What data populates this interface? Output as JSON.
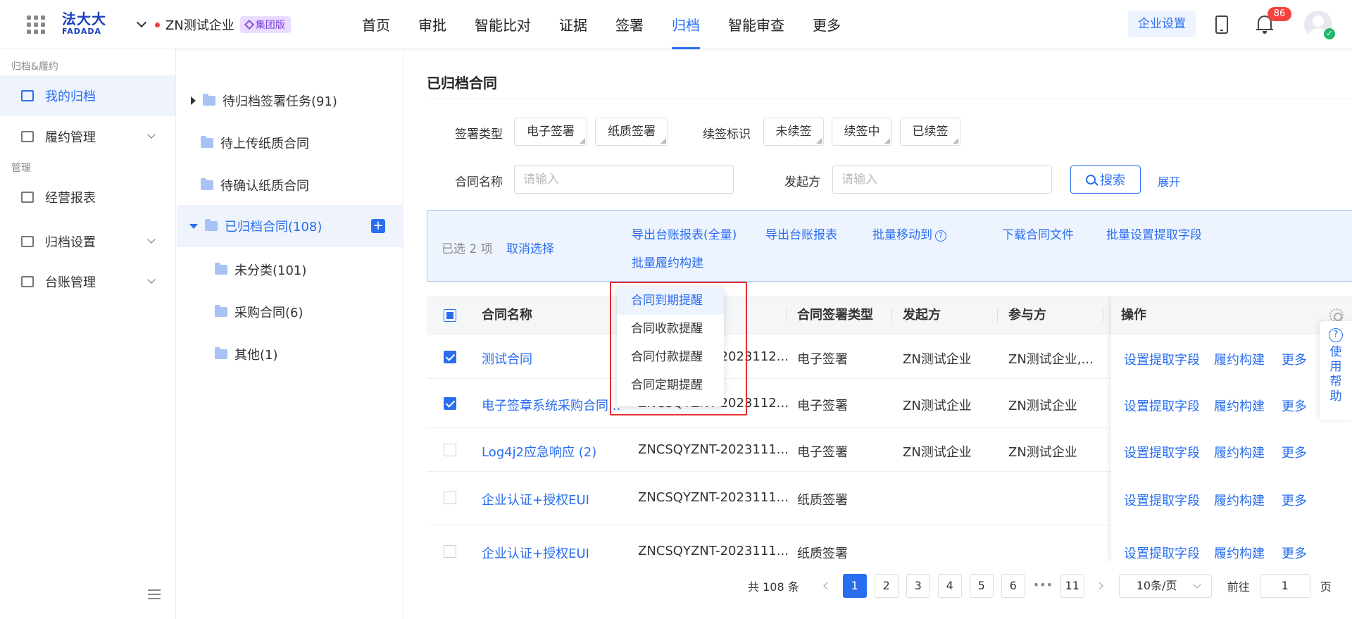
{
  "header": {
    "logo_line1": "法大大",
    "logo_line2": "FADADA",
    "company": "ZN测试企业",
    "company_badge": "集团版",
    "nav": [
      "首页",
      "审批",
      "智能比对",
      "证据",
      "签署",
      "归档",
      "智能审查",
      "更多"
    ],
    "active_nav": "归档",
    "enterprise_settings": "企业设置",
    "notification_count": "86"
  },
  "sidebar": {
    "section1": "归档&履约",
    "section2": "管理",
    "items": [
      {
        "label": "我的归档"
      },
      {
        "label": "履约管理"
      },
      {
        "label": "经营报表"
      },
      {
        "label": "归档设置"
      },
      {
        "label": "台账管理"
      }
    ]
  },
  "tree": {
    "items": [
      {
        "label": "待归档签署任务(91)"
      },
      {
        "label": "待上传纸质合同"
      },
      {
        "label": "待确认纸质合同"
      },
      {
        "label": "已归档合同(108)"
      },
      {
        "label": "未分类(101)"
      },
      {
        "label": "采购合同(6)"
      },
      {
        "label": "其他(1)"
      }
    ]
  },
  "main": {
    "title": "已归档合同",
    "filters": {
      "sign_type_label": "签署类型",
      "sign_type_tags": [
        "电子签署",
        "纸质签署"
      ],
      "renew_label": "续签标识",
      "renew_tags": [
        "未续签",
        "续签中",
        "已续签"
      ],
      "contract_name_label": "合同名称",
      "contract_name_placeholder": "请输入",
      "initiator_label": "发起方",
      "initiator_placeholder": "请输入",
      "search_button": "搜索",
      "expand_link": "展开"
    },
    "bulk": {
      "selected": "已选 2 项",
      "cancel": "取消选择",
      "actions": [
        "导出台账报表(全量)",
        "导出台账报表",
        "批量移动到",
        "下载合同文件",
        "批量设置提取字段",
        "批量履约构建"
      ]
    },
    "dropdown": [
      "合同到期提醒",
      "合同收款提醒",
      "合同付款提醒",
      "合同定期提醒"
    ],
    "table": {
      "headers": [
        "合同名称",
        "合同签署类型",
        "发起方",
        "参与方",
        "操作"
      ],
      "rows": [
        {
          "name": "测试合同",
          "code": "ZNCSQYZNT-2023112...",
          "type": "电子签署",
          "initiator": "ZN测试企业",
          "party": "ZN测试企业,...",
          "checked": true
        },
        {
          "name": "电子签章系统采购合同...",
          "code": "ZNCSQYZNT-2023112...",
          "type": "电子签署",
          "initiator": "ZN测试企业",
          "party": "ZN测试企业",
          "checked": true
        },
        {
          "name": "Log4j2应急响应 (2)",
          "code": "ZNCSQYZNT-2023111...",
          "type": "电子签署",
          "initiator": "ZN测试企业",
          "party": "ZN测试企业",
          "checked": false
        },
        {
          "name": "企业认证+授权EUI",
          "code": "ZNCSQYZNT-2023111...",
          "type": "纸质签署",
          "initiator": "",
          "party": "",
          "checked": false
        },
        {
          "name": "企业认证+授权EUI",
          "code": "ZNCSQYZNT-2023111...",
          "type": "纸质签署",
          "initiator": "",
          "party": "",
          "checked": false
        }
      ],
      "ops": [
        "设置提取字段",
        "履约构建",
        "更多"
      ]
    },
    "pagination": {
      "total": "共 108 条",
      "pages": [
        "1",
        "2",
        "3",
        "4",
        "5",
        "6"
      ],
      "ellipsis": "•••",
      "last": "11",
      "page_size": "10条/页",
      "goto_label": "前往",
      "goto_value": "1",
      "page_unit": "页"
    }
  },
  "help_float": [
    "使",
    "用",
    "帮",
    "助"
  ]
}
